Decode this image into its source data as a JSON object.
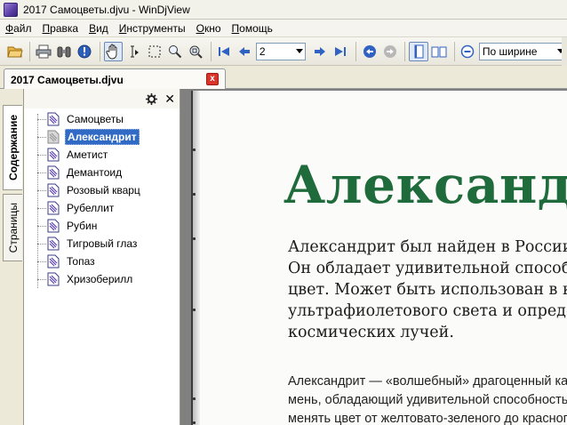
{
  "window": {
    "title": "2017 Самоцветы.djvu - WinDjView"
  },
  "menu": [
    {
      "label": "Файл",
      "key": "Ф",
      "rest": "айл"
    },
    {
      "label": "Правка",
      "key": "П",
      "rest": "равка"
    },
    {
      "label": "Вид",
      "key": "В",
      "rest": "ид"
    },
    {
      "label": "Инструменты",
      "key": "И",
      "rest": "нструменты"
    },
    {
      "label": "Окно",
      "key": "О",
      "rest": "кно"
    },
    {
      "label": "Помощь",
      "key": "П",
      "rest": "омощь"
    }
  ],
  "toolbar": {
    "page_number": "2",
    "zoom_mode": "По ширине"
  },
  "tab": {
    "label": "2017 Самоцветы.djvu",
    "close": "x"
  },
  "side_tabs": {
    "contents": "Содержание",
    "pages": "Страницы"
  },
  "panel": {
    "close": "✕"
  },
  "contents": [
    "Самоцветы",
    "Александрит",
    "Аметист",
    "Демантоид",
    "Розовый кварц",
    "Рубеллит",
    "Рубин",
    "Тигровый глаз",
    "Топаз",
    "Хризоберилл"
  ],
  "selected_index": 1,
  "document": {
    "headline": "Александрит",
    "lead": [
      "Александрит был найден в России.",
      "Он обладает удивительной способностью менять",
      "цвет. Может быть использован в качестве",
      "ультрафиолетового света и определения",
      "космических лучей."
    ],
    "body": [
      "Александрит — «волшебный» драгоценный ка-",
      "мень, обладающий удивительной способностью",
      "менять цвет от желтовато-зеленого до красного"
    ]
  },
  "colors": {
    "headline": "#1f6b3c",
    "selection": "#316ac5",
    "tab_close": "#d9332a"
  }
}
